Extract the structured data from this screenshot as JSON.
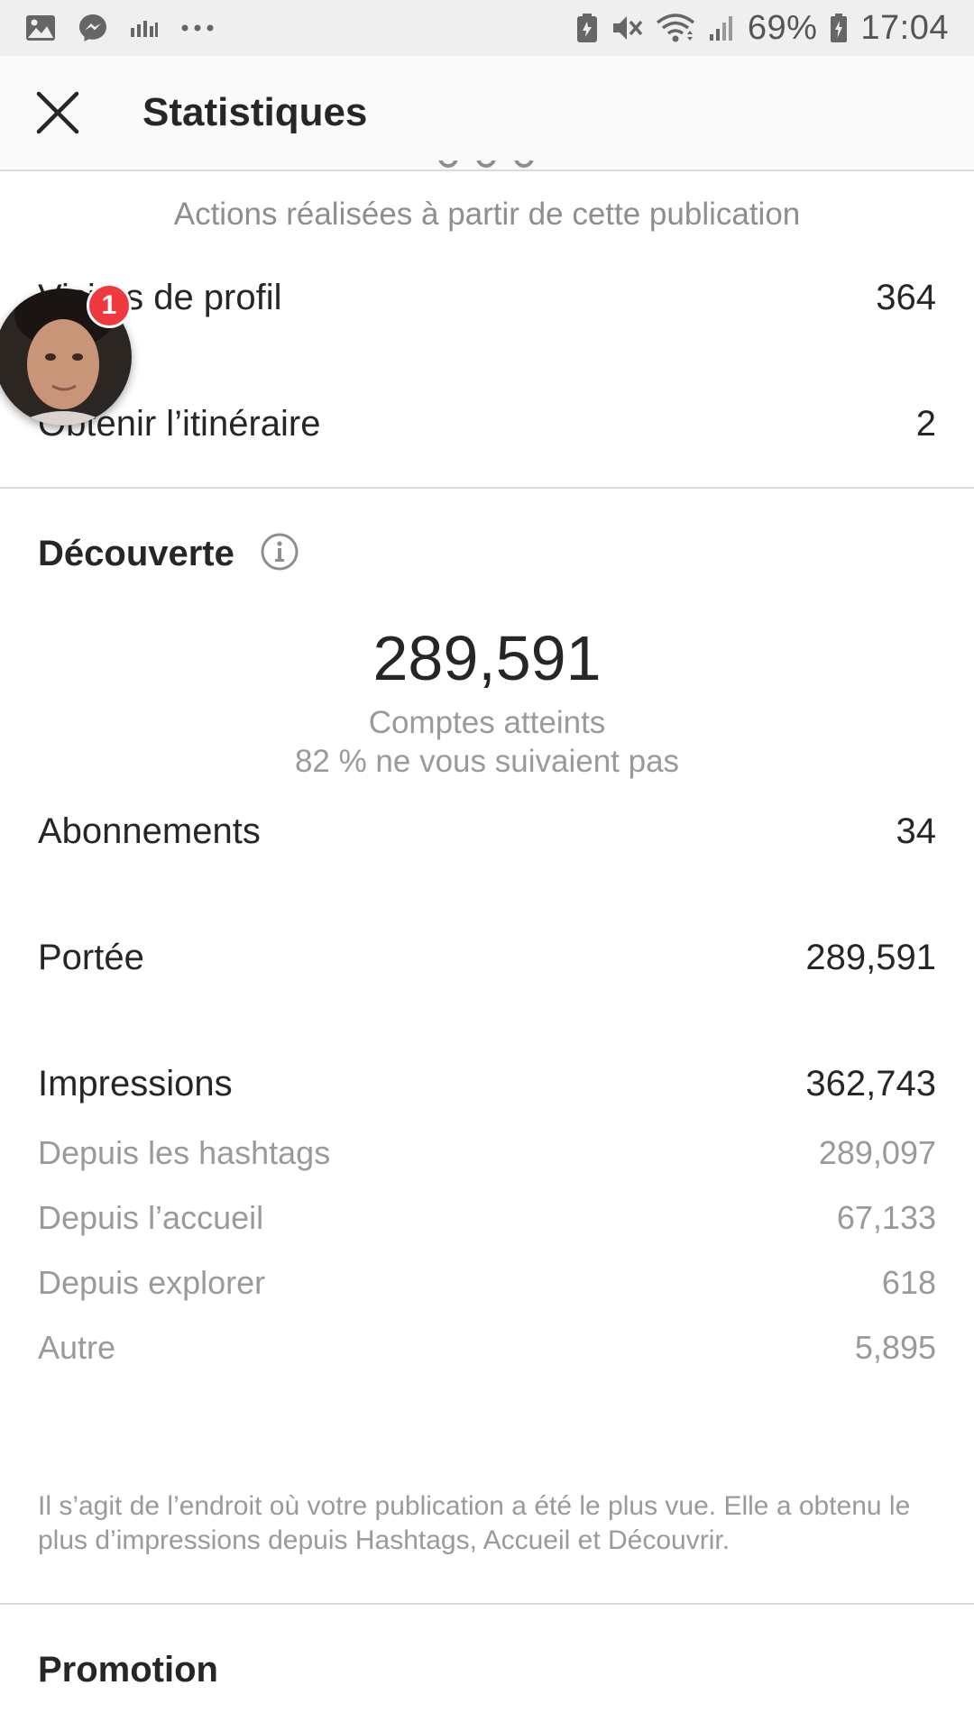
{
  "status_bar": {
    "battery": "69%",
    "time": "17:04",
    "left_icons": [
      "gallery-icon",
      "messenger-icon",
      "chart-icon",
      "more-icon"
    ],
    "right_icons": [
      "battery-saver-icon",
      "mute-icon",
      "wifi-icon",
      "signal-icon",
      "battery-icon"
    ]
  },
  "header": {
    "title": "Statistiques",
    "close_icon": "close-icon"
  },
  "interactions": {
    "caption": "Actions réalisées à partir de cette publication",
    "rows": [
      {
        "label": "Visites de profil",
        "value": "364"
      },
      {
        "label": "Obtenir l’itinéraire",
        "value": "2"
      }
    ]
  },
  "discovery": {
    "title": "Découverte",
    "info_icon": "info-icon",
    "accounts_reached": "289,591",
    "accounts_caption": "Comptes atteints",
    "non_followers": "82 % ne vous suivaient pas",
    "rows": [
      {
        "label": "Abonnements",
        "value": "34"
      },
      {
        "label": "Portée",
        "value": "289,591"
      },
      {
        "label": "Impressions",
        "value": "362,743"
      }
    ],
    "sub_rows": [
      {
        "label": "Depuis les hashtags",
        "value": "289,097"
      },
      {
        "label": "Depuis l’accueil",
        "value": "67,133"
      },
      {
        "label": "Depuis explorer",
        "value": "618"
      },
      {
        "label": "Autre",
        "value": "5,895"
      }
    ],
    "footnote": "Il s’agit de l’endroit où votre publication a été le plus vue. Elle a obtenu le plus d’impressions depuis Hashtags, Accueil et Découvrir."
  },
  "promotion": {
    "title": "Promotion"
  },
  "chat_head": {
    "badge": "1",
    "colors": {
      "badge": "#f0383f"
    }
  }
}
